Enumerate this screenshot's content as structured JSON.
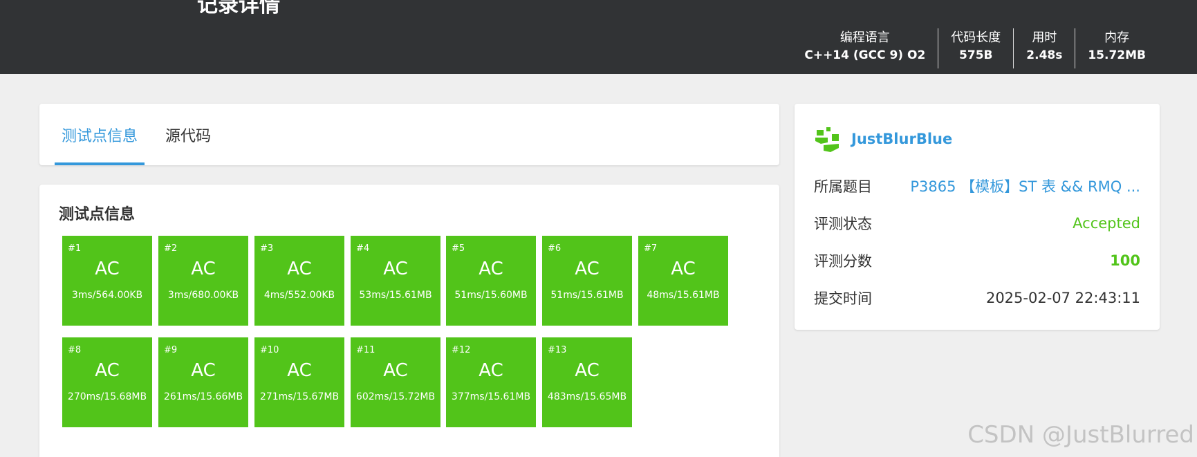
{
  "header": {
    "title": "记录详情",
    "stats": [
      {
        "label": "编程语言",
        "value": "C++14 (GCC 9) O2"
      },
      {
        "label": "代码长度",
        "value": "575B"
      },
      {
        "label": "用时",
        "value": "2.48s"
      },
      {
        "label": "内存",
        "value": "15.72MB"
      }
    ]
  },
  "tabs": [
    {
      "label": "测试点信息",
      "active": true
    },
    {
      "label": "源代码",
      "active": false
    }
  ],
  "tests": {
    "title": "测试点信息",
    "cases": [
      {
        "num": "#1",
        "status": "AC",
        "stat": "3ms/564.00KB"
      },
      {
        "num": "#2",
        "status": "AC",
        "stat": "3ms/680.00KB"
      },
      {
        "num": "#3",
        "status": "AC",
        "stat": "4ms/552.00KB"
      },
      {
        "num": "#4",
        "status": "AC",
        "stat": "53ms/15.61MB"
      },
      {
        "num": "#5",
        "status": "AC",
        "stat": "51ms/15.60MB"
      },
      {
        "num": "#6",
        "status": "AC",
        "stat": "51ms/15.61MB"
      },
      {
        "num": "#7",
        "status": "AC",
        "stat": "48ms/15.61MB"
      },
      {
        "num": "#8",
        "status": "AC",
        "stat": "270ms/15.68MB"
      },
      {
        "num": "#9",
        "status": "AC",
        "stat": "261ms/15.66MB"
      },
      {
        "num": "#10",
        "status": "AC",
        "stat": "271ms/15.67MB"
      },
      {
        "num": "#11",
        "status": "AC",
        "stat": "602ms/15.72MB"
      },
      {
        "num": "#12",
        "status": "AC",
        "stat": "377ms/15.61MB"
      },
      {
        "num": "#13",
        "status": "AC",
        "stat": "483ms/15.65MB"
      }
    ]
  },
  "sidebar": {
    "user": {
      "name": "JustBlurBlue",
      "logo_icon": "user-avatar-logo-icon"
    },
    "rows": [
      {
        "label": "所属题目",
        "value": "P3865 【模板】ST 表 && RMQ ..."
      },
      {
        "label": "评测状态",
        "value": "Accepted"
      },
      {
        "label": "评测分数",
        "value": "100"
      },
      {
        "label": "提交时间",
        "value": "2025-02-07 22:43:11"
      }
    ]
  },
  "watermark": "CSDN @JustBlurred",
  "colors": {
    "accent": "#3498db",
    "ac": "#52c41a",
    "header_bg": "#313335",
    "page_bg": "#efefef"
  }
}
